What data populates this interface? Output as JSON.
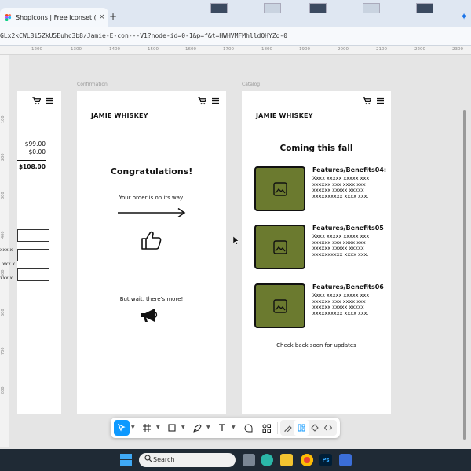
{
  "browser": {
    "tab_title": "Shopicons | Free Iconset (Com",
    "tab_close": "×",
    "new_tab": "+",
    "url": "GLx2kCWL8i5ZkU5Euhc3b8/Jamie-E-con---V1?node-id=0-1&p=f&t=HWHVMFMhlldQHYZq-0",
    "accent": "#1a73e8"
  },
  "ruler": {
    "top_ticks": [
      "1200",
      "1300",
      "1400",
      "1500",
      "1600",
      "1700",
      "1800",
      "1900",
      "2000",
      "2100",
      "2200",
      "2300"
    ],
    "left_ticks": [
      "100",
      "200",
      "300",
      "400",
      "500",
      "600",
      "700",
      "800"
    ]
  },
  "frames": {
    "confirmation_label": "Confirmation",
    "catalog_label": "Catalog"
  },
  "left_frame": {
    "price1": "$99.00",
    "price2": "$0.00",
    "total": "$108.00",
    "field_text": "xxx x"
  },
  "confirmation": {
    "brand": "JAMIE WHISKEY",
    "heading": "Congratulations!",
    "message": "Your order is on its way.",
    "teaser": "But wait, there's more!"
  },
  "catalog": {
    "brand": "JAMIE WHISKEY",
    "heading": "Coming this fall",
    "products": [
      {
        "title": "Features/Benefits04:",
        "desc": "Xxxx xxxxx xxxxx xxx xxxxxx xxx xxxx xxx xxxxxx xxxxx xxxxx xxxxxxxxxx xxxx xxx."
      },
      {
        "title": "Features/Benefits05",
        "desc": "Xxxx xxxxx xxxxx xxx xxxxxx xxx xxxx xxx xxxxxx xxxxx xxxxx xxxxxxxxxx xxxx xxx."
      },
      {
        "title": "Features/Benefits06",
        "desc": "Xxxx xxxxx xxxxx xxx xxxxxx xxx xxxx xxx xxxxxx xxxxx xxxxx xxxxxxxxxx xxxx xxx."
      }
    ],
    "footer": "Check back soon for updates",
    "product_color": "#6b7a2f"
  },
  "toolbar": {
    "active_color": "#0d99ff"
  },
  "taskbar": {
    "search_label": "Search"
  }
}
